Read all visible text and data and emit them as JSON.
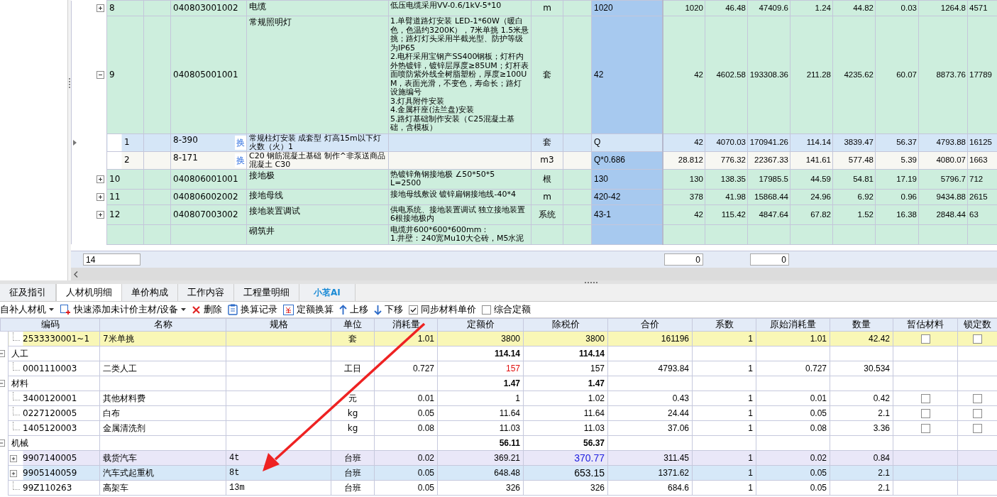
{
  "top_grid": {
    "rows": [
      {
        "no": "8",
        "code": "040803001002",
        "name": "电缆",
        "desc": "低压电缆采用VV-0.6/1kV-5*10",
        "unit": "m",
        "expr": "1020",
        "values": [
          "1020",
          "46.48",
          "47409.6",
          "1.24",
          "44.82",
          "0.03",
          "1264.8",
          "4571"
        ],
        "expanded": false
      },
      {
        "no": "9",
        "code": "040805001001",
        "name": "常规照明灯",
        "desc": "1.单臂道路灯安装 LED-1*60W（暖白色，色温约3200K），7米单挑 1.5米悬挑；路灯灯头采用半截光型、防护等级为IP65\n2.电杆采用宝钢产SS400钢板；灯杆内外热镀锌，镀锌层厚度≥85UM；灯杆表面喷防紫外线全树脂塑粉，厚度≥100UM，表面光滑，不变色，寿命长；路灯设施编号\n3.灯具附件安装\n4.金属杆座(法兰盘)安装\n5.路灯基础制作安装（C25混凝土基础，含模板）",
        "unit": "套",
        "expr": "42",
        "values": [
          "42",
          "4602.58",
          "193308.36",
          "211.28",
          "4235.62",
          "60.07",
          "8873.76",
          "17789"
        ],
        "expanded": true,
        "children": [
          {
            "no": "1",
            "code": "8-390",
            "badge": "换",
            "name": "常规柱灯安装 成套型 灯高15m以下灯火数（火）1",
            "unit": "套",
            "expr": "Q",
            "values": [
              "42",
              "4070.03",
              "170941.26",
              "114.14",
              "3839.47",
              "56.37",
              "4793.88",
              "16125"
            ],
            "selected": true
          },
          {
            "no": "2",
            "code": "8-171",
            "badge": "换",
            "name": "C20 钢筋混凝土基础 制作^非泵送商品混凝土 C30",
            "unit": "m3",
            "expr": "Q*0.686",
            "values": [
              "28.812",
              "776.32",
              "22367.33",
              "141.61",
              "577.48",
              "5.39",
              "4080.07",
              "1663"
            ],
            "selected": false
          }
        ]
      },
      {
        "no": "10",
        "code": "040806001001",
        "name": "接地极",
        "desc": "热镀锌角钢接地极 ∠50*50*5\nL=2500",
        "unit": "根",
        "expr": "130",
        "values": [
          "130",
          "138.35",
          "17985.5",
          "44.59",
          "54.81",
          "17.19",
          "5796.7",
          "712"
        ],
        "expanded": false
      },
      {
        "no": "11",
        "code": "040806002002",
        "name": "接地母线",
        "desc": "接地母线敷设 镀锌扁钢接地线-40*4",
        "unit": "m",
        "expr": "420-42",
        "values": [
          "378",
          "41.98",
          "15868.44",
          "24.96",
          "6.92",
          "0.96",
          "9434.88",
          "2615"
        ],
        "expanded": false
      },
      {
        "no": "12",
        "code": "040807003002",
        "name": "接地装置调试",
        "desc": "供电系统、接地装置调试 独立接地装置6根接地极内",
        "unit": "系统",
        "expr": "43-1",
        "values": [
          "42",
          "115.42",
          "4847.64",
          "67.82",
          "1.52",
          "16.38",
          "2848.44",
          "63"
        ],
        "expanded": false
      },
      {
        "name": "砌筑井",
        "desc": "电缆井600*600*600mm：\n1.井壁：240宽Mu10大仑砖，M5水泥"
      }
    ],
    "footer": {
      "count": "14",
      "total_1": "0",
      "total_2": "0"
    }
  },
  "bottom_panel": {
    "tabs": [
      {
        "label": "征及指引",
        "selected": false
      },
      {
        "label": "人材机明细",
        "selected": true
      },
      {
        "label": "单价构成",
        "selected": false
      },
      {
        "label": "工作内容",
        "selected": false
      },
      {
        "label": "工程量明细",
        "selected": false
      },
      {
        "label": "小茗AI",
        "selected": false,
        "kind": "ai"
      }
    ],
    "toolbar": [
      {
        "kind": "plain",
        "label": "自补人材机",
        "menu": true
      },
      {
        "kind": "add",
        "label": "快速添加未计价主材/设备",
        "menu": true
      },
      {
        "kind": "delete",
        "label": "删除"
      },
      {
        "kind": "record",
        "label": "换算记录"
      },
      {
        "kind": "convert",
        "label": "定额换算"
      },
      {
        "kind": "up",
        "label": "上移"
      },
      {
        "kind": "down",
        "label": "下移"
      },
      {
        "kind": "checkbox",
        "label": "同步材料单价",
        "checked": true
      },
      {
        "kind": "checkbox",
        "label": "综合定额",
        "checked": false
      }
    ],
    "grid": {
      "columns": [
        "编码",
        "名称",
        "规格",
        "单位",
        "消耗量",
        "定额价",
        "除税价",
        "合价",
        "系数",
        "原始消耗量",
        "数量",
        "暂估材料",
        "锁定数"
      ],
      "rows": [
        {
          "kind": "item",
          "code": "2533330001~1",
          "name": "7米单挑",
          "unit": "套",
          "qty": "1.01",
          "price": "3800",
          "tax_price": "3800",
          "total": "161196",
          "factor": "1",
          "orig_qty": "1.01",
          "amount": "42.42",
          "estimated": false,
          "locked": false,
          "selected": false,
          "color": "#f9f7b6"
        },
        {
          "kind": "category",
          "label": "人工",
          "price": "114.14",
          "tax_price": "114.14",
          "expanded": true,
          "children": [
            {
              "kind": "item",
              "code": "0001110003",
              "name": "二类人工",
              "unit": "工日",
              "qty": "0.727",
              "price": "157",
              "price_changed": true,
              "tax_price": "157",
              "total": "4793.84",
              "factor": "1",
              "orig_qty": "0.727",
              "amount": "30.534",
              "selected": false
            }
          ]
        },
        {
          "kind": "category",
          "label": "材料",
          "price": "1.47",
          "tax_price": "1.47",
          "expanded": true,
          "children": [
            {
              "kind": "item",
              "code": "3400120001",
              "name": "其他材料费",
              "unit": "元",
              "qty": "0.01",
              "price": "1",
              "tax_price": "1.02",
              "total": "0.43",
              "factor": "1",
              "orig_qty": "0.01",
              "amount": "0.42",
              "estimated": false,
              "locked": false,
              "selected": false
            },
            {
              "kind": "item",
              "code": "0227120005",
              "name": "白布",
              "unit": "kg",
              "qty": "0.05",
              "price": "11.64",
              "tax_price": "11.64",
              "total": "24.44",
              "factor": "1",
              "orig_qty": "0.05",
              "amount": "2.1",
              "estimated": false,
              "locked": false,
              "selected": false
            },
            {
              "kind": "item",
              "code": "1405120003",
              "name": "金属清洗剂",
              "unit": "kg",
              "qty": "0.08",
              "price": "11.03",
              "tax_price": "11.03",
              "total": "37.06",
              "factor": "1",
              "orig_qty": "0.08",
              "amount": "3.36",
              "estimated": false,
              "locked": false,
              "selected": false
            }
          ]
        },
        {
          "kind": "category",
          "label": "机械",
          "price": "56.11",
          "tax_price": "56.37",
          "expanded": true,
          "children": [
            {
              "kind": "item",
              "code": "9907140005",
              "name": "载货汽车",
              "spec": "4t",
              "unit": "台班",
              "qty": "0.02",
              "price": "369.21",
              "tax_price": "370.77",
              "tax_price_changed": true,
              "tax_price_emphasized": true,
              "total": "311.45",
              "factor": "1",
              "orig_qty": "0.02",
              "amount": "0.84",
              "expanded": false,
              "selected": false,
              "color": "#e9e7f8"
            },
            {
              "kind": "item",
              "code": "9905140059",
              "name": "汽车式起重机",
              "spec": "8t",
              "unit": "台班",
              "qty": "0.05",
              "price": "648.48",
              "tax_price": "653.15",
              "tax_price_changed": false,
              "tax_price_emphasized": true,
              "total": "1371.62",
              "factor": "1",
              "orig_qty": "0.05",
              "amount": "2.1",
              "expanded": false,
              "selected": true
            },
            {
              "kind": "item",
              "code": "99Z110263",
              "name": "高架车",
              "spec": "13m",
              "unit": "台班",
              "qty": "0.05",
              "price": "326",
              "tax_price": "326",
              "total": "684.6",
              "factor": "1",
              "orig_qty": "0.05",
              "amount": "2.1",
              "selected": false
            }
          ]
        }
      ]
    }
  }
}
